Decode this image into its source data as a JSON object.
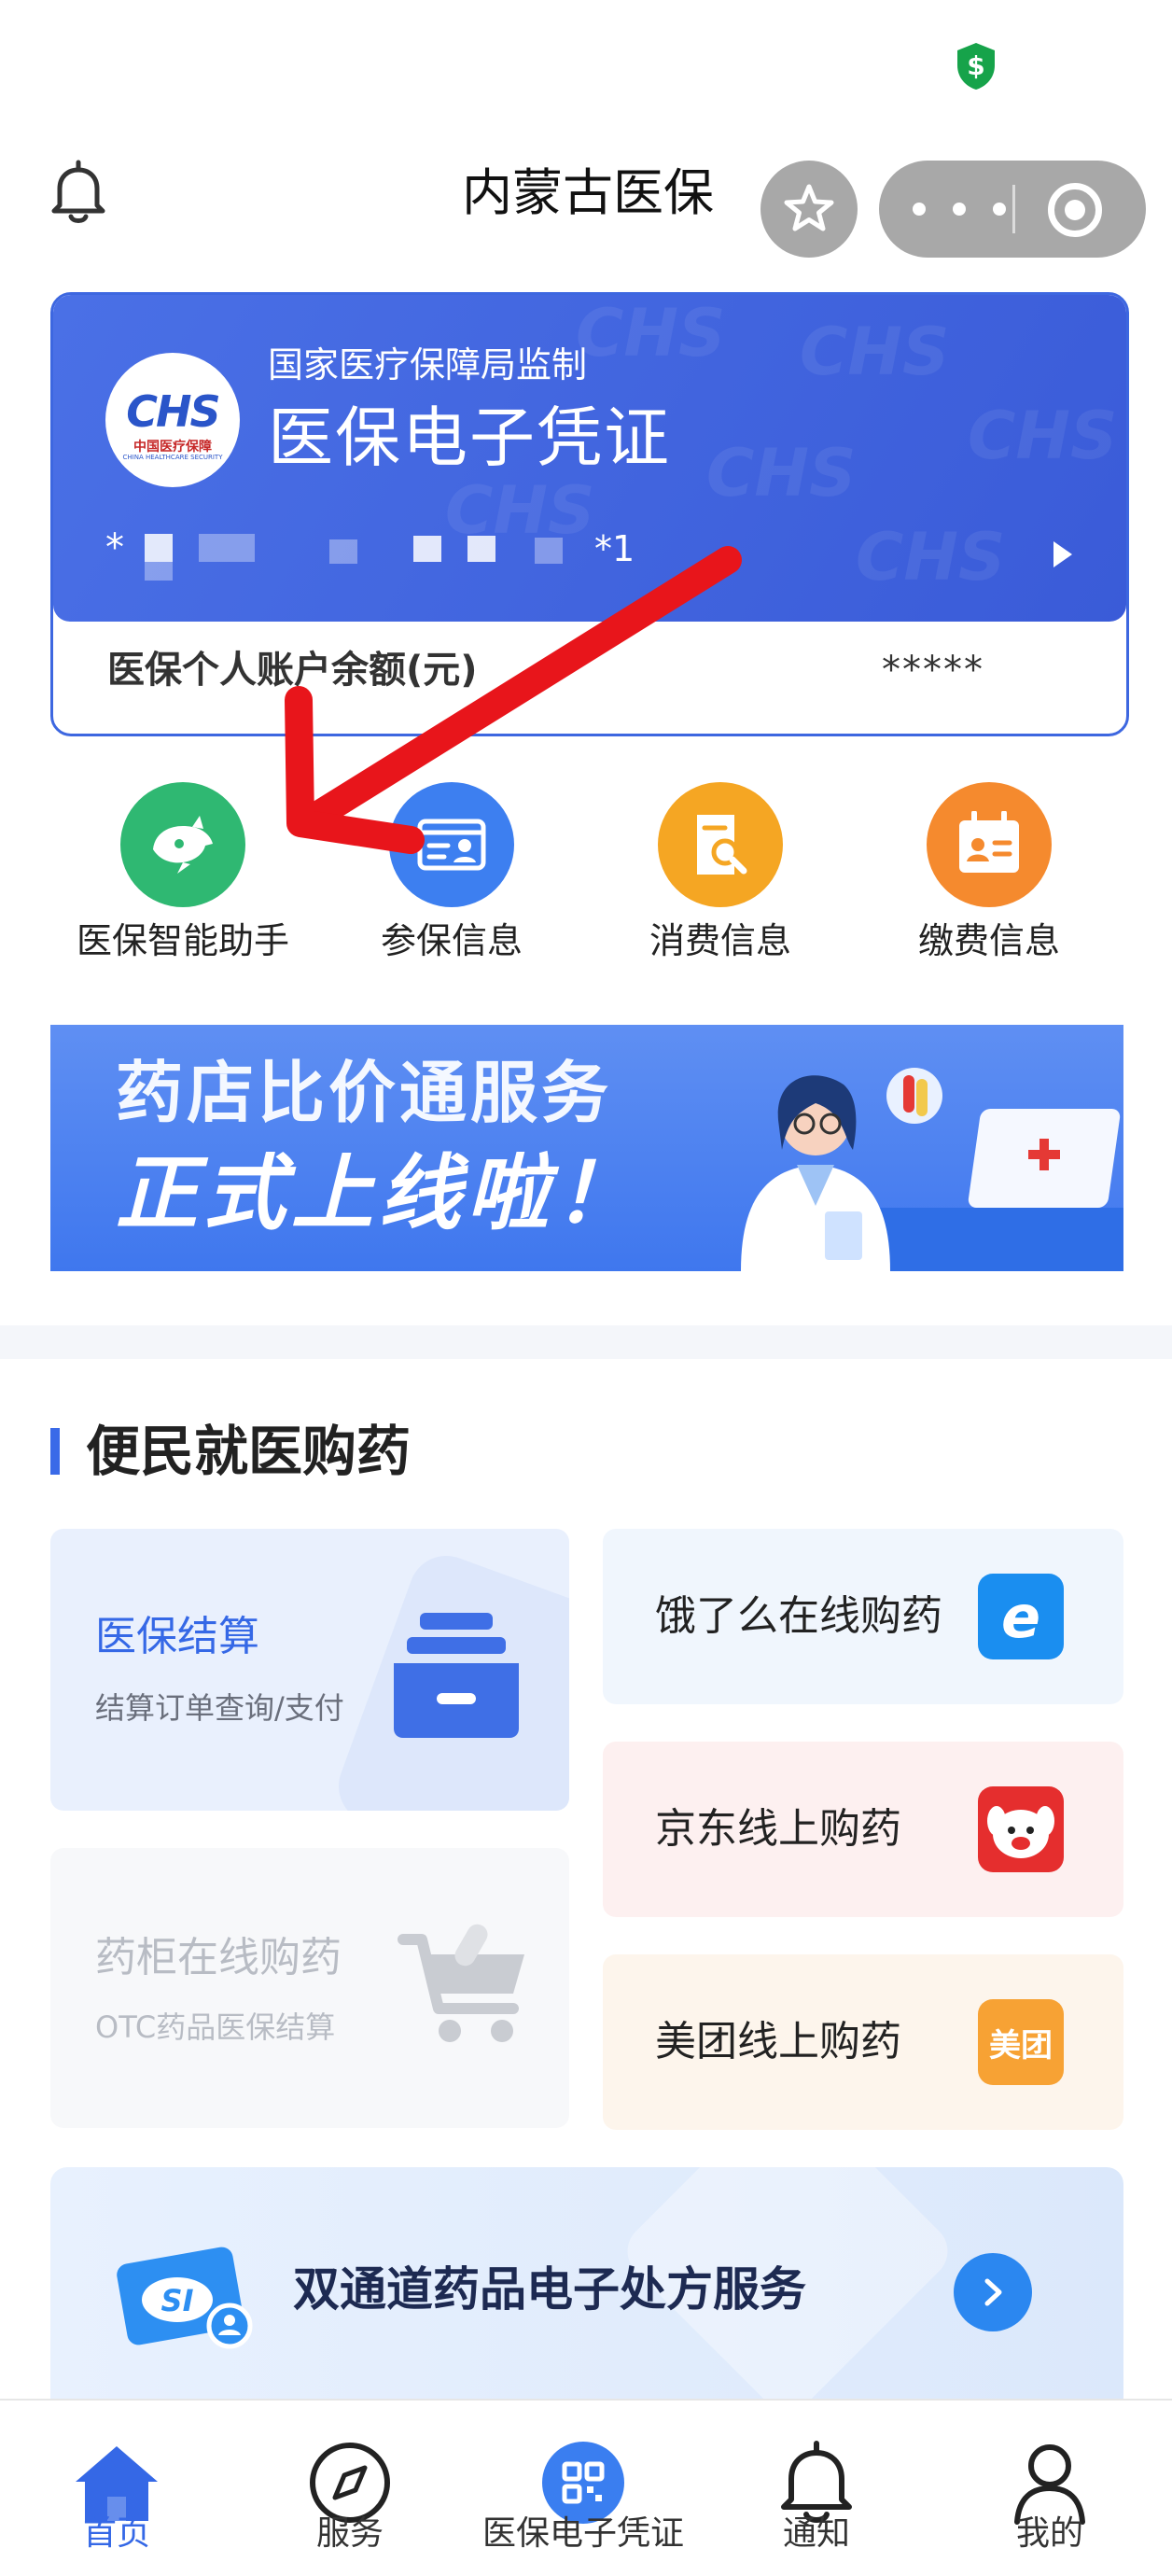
{
  "header": {
    "title": "内蒙古医保"
  },
  "card": {
    "supervision": "国家医疗保障局监制",
    "title": "医保电子凭证",
    "logo_text": "CHS",
    "logo_cn": "中国医疗保障",
    "logo_en": "CHINA HEALTHCARE SECURITY",
    "number_prefix": "*",
    "number_suffix": "*1",
    "balance_label": "医保个人账户余额(元)",
    "balance_value": "*****"
  },
  "quick_actions": [
    {
      "label": "医保智能助手",
      "icon": "dolphin-icon",
      "color": "#2fb872"
    },
    {
      "label": "参保信息",
      "icon": "id-card-icon",
      "color": "#3d7ff0"
    },
    {
      "label": "消费信息",
      "icon": "receipt-search-icon",
      "color": "#f5a623"
    },
    {
      "label": "缴费信息",
      "icon": "calendar-id-icon",
      "color": "#f58a2e"
    }
  ],
  "banner": {
    "line1": "药店比价通服务",
    "line2": "正式上线啦！"
  },
  "section": {
    "title": "便民就医购药"
  },
  "services": {
    "settlement": {
      "name": "医保结算",
      "desc": "结算订单查询/支付"
    },
    "cabinet": {
      "name": "药柜在线购药",
      "desc": "OTC药品医保结算"
    },
    "eleme": {
      "name": "饿了么在线购药",
      "icon_text": "e"
    },
    "jd": {
      "name": "京东线上购药"
    },
    "meituan": {
      "name": "美团线上购药",
      "icon_text": "美团"
    }
  },
  "prescription": {
    "title": "双通道药品电子处方服务",
    "icon_text": "SI"
  },
  "tabs": [
    {
      "label": "首页",
      "icon": "home-icon"
    },
    {
      "label": "服务",
      "icon": "compass-icon"
    },
    {
      "label": "医保电子凭证",
      "icon": "qr-code-icon"
    },
    {
      "label": "通知",
      "icon": "bell-icon"
    },
    {
      "label": "我的",
      "icon": "user-icon"
    }
  ],
  "colors": {
    "primary": "#3568e6",
    "card_blue": "#4068e0",
    "arrow_red": "#e8151b"
  }
}
